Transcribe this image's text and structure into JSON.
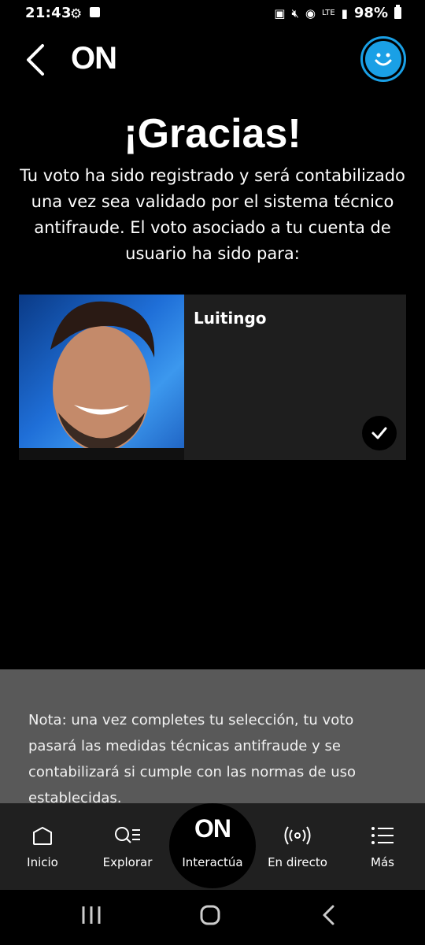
{
  "status_bar": {
    "time": "21:43",
    "network": "LTE",
    "battery": "98%"
  },
  "header": {
    "logo": "ON"
  },
  "confirmation": {
    "title": "¡Gracias!",
    "message": "Tu voto ha sido registrado y será contabilizado una vez sea validado por el sistema técnico antifraude. El voto asociado a tu cuenta de usuario ha sido para:"
  },
  "vote_card": {
    "name": "Luitingo",
    "selected": true
  },
  "note": {
    "text": "Nota: una vez completes tu selección, tu voto pasará las medidas técnicas antifraude y se contabilizará si cumple con las normas de uso establecidas."
  },
  "tab_bar": {
    "items": [
      {
        "label": "Inicio",
        "icon": "home-icon"
      },
      {
        "label": "Explorar",
        "icon": "search-list-icon"
      },
      {
        "label": "Interactúa",
        "icon": "on-logo-icon",
        "logo": "ON"
      },
      {
        "label": "En directo",
        "icon": "broadcast-icon"
      },
      {
        "label": "Más",
        "icon": "menu-icon"
      }
    ],
    "active_index": 2
  },
  "colors": {
    "background": "#000000",
    "accent": "#1aa0e6",
    "card": "#1e1e1e",
    "note_background": "#595959",
    "tab_bar": "#202020"
  }
}
